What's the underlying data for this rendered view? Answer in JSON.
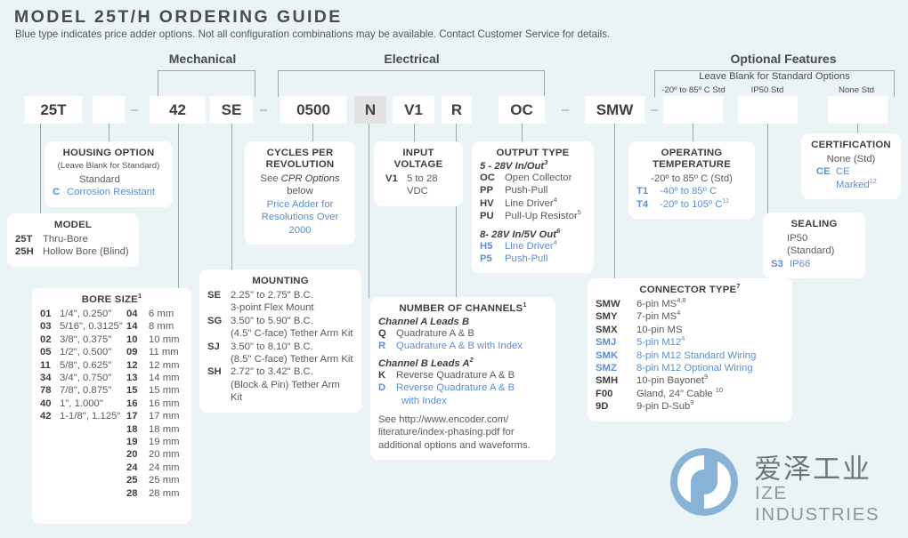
{
  "header": {
    "title": "MODEL 25T/H ORDERING GUIDE",
    "subtitle": "Blue type indicates price adder options. Not all configuration combinations may be available. Contact Customer Service for details."
  },
  "groups": {
    "mechanical": "Mechanical",
    "electrical": "Electrical",
    "optional_features": "Optional Features",
    "leave_blank": "Leave Blank for Standard Options"
  },
  "std_notes": {
    "temp": "-20º to 85º C Std",
    "sealing": "IP50 Std",
    "certification": "None Std"
  },
  "part_number": {
    "model": "25T",
    "housing": "",
    "dash1": "–",
    "bore": "42",
    "mounting": "SE",
    "dash2": "–",
    "cpr": "0500",
    "channels": "N",
    "voltage": "V1",
    "index": "R",
    "output": "OC",
    "dash3": "–",
    "connector": "SMW",
    "dash4": "–",
    "temperature": "",
    "sealing": "",
    "certification": ""
  },
  "housing_option": {
    "title": "HOUSING OPTION",
    "sub": "(Leave Blank for Standard)",
    "rows": [
      {
        "code": "",
        "desc": "Standard",
        "blue": false
      },
      {
        "code": "C",
        "desc": "Corrosion Resistant",
        "blue": true
      }
    ]
  },
  "model": {
    "title": "MODEL",
    "rows": [
      {
        "code": "25T",
        "desc": "Thru-Bore",
        "blue": false
      },
      {
        "code": "25H",
        "desc": "Hollow Bore (Blind)",
        "blue": false
      }
    ]
  },
  "bore_size": {
    "title": "BORE SIZE",
    "title_sup": "1",
    "col1": [
      {
        "code": "01",
        "desc": "1/4\", 0.250\""
      },
      {
        "code": "03",
        "desc": "5/16\", 0.3125\""
      },
      {
        "code": "02",
        "desc": "3/8\", 0.375\""
      },
      {
        "code": "05",
        "desc": "1/2\", 0.500\""
      },
      {
        "code": "11",
        "desc": "5/8\", 0.625\""
      },
      {
        "code": "34",
        "desc": "3/4\", 0.750\""
      },
      {
        "code": "78",
        "desc": "7/8\", 0.875\""
      },
      {
        "code": "40",
        "desc": "1\", 1.000\""
      },
      {
        "code": "42",
        "desc": "1-1/8\", 1.125\""
      }
    ],
    "col2": [
      {
        "code": "04",
        "desc": "6 mm"
      },
      {
        "code": "14",
        "desc": "8 mm"
      },
      {
        "code": "10",
        "desc": "10 mm"
      },
      {
        "code": "09",
        "desc": "11 mm"
      },
      {
        "code": "12",
        "desc": "12 mm"
      },
      {
        "code": "13",
        "desc": "14 mm"
      },
      {
        "code": "15",
        "desc": "15 mm"
      },
      {
        "code": "16",
        "desc": "16 mm"
      },
      {
        "code": "17",
        "desc": "17 mm"
      },
      {
        "code": "18",
        "desc": "18 mm"
      },
      {
        "code": "19",
        "desc": "19 mm"
      },
      {
        "code": "20",
        "desc": "20 mm"
      },
      {
        "code": "24",
        "desc": "24 mm"
      },
      {
        "code": "25",
        "desc": "25 mm"
      },
      {
        "code": "28",
        "desc": "28 mm"
      }
    ]
  },
  "cycles_per_revolution": {
    "title_line1": "CYCLES PER",
    "title_line2": "REVOLUTION",
    "line1_pre": "See ",
    "line1_ital": "CPR Options",
    "line1_post": " below",
    "blue_line1": "Price Adder for",
    "blue_line2": "Resolutions Over 2000"
  },
  "mounting": {
    "title": "MOUNTING",
    "rows": [
      {
        "code": "SE",
        "desc": "2.25\" to 2.75\" B.C.",
        "desc2": "3-point Flex Mount"
      },
      {
        "code": "SG",
        "desc": "3.50\" to 5.90\" B.C.",
        "desc2": "(4.5\" C-face) Tether Arm Kit"
      },
      {
        "code": "SJ",
        "desc": "3.50\" to 8.10\" B.C.",
        "desc2": "(8.5\" C-face) Tether Arm Kit"
      },
      {
        "code": "SH",
        "desc": "2.72\" to 3.42\" B.C.",
        "desc2": "(Block & Pin) Tether Arm Kit"
      }
    ]
  },
  "input_voltage": {
    "title_line1": "INPUT",
    "title_line2": "VOLTAGE",
    "rows": [
      {
        "code": "V1",
        "desc": "5 to 28 VDC",
        "blue": false
      }
    ]
  },
  "output_type": {
    "title": "OUTPUT TYPE",
    "group1_label": "5 - 28V In/Out",
    "group1_sup": "3",
    "group1": [
      {
        "code": "OC",
        "desc": "Open Collector",
        "sup": "",
        "blue": false
      },
      {
        "code": "PP",
        "desc": "Push-Pull",
        "sup": "",
        "blue": false
      },
      {
        "code": "HV",
        "desc": "Line Driver",
        "sup": "4",
        "blue": false
      },
      {
        "code": "PU",
        "desc": "Pull-Up Resistor",
        "sup": "5",
        "blue": false
      }
    ],
    "group2_label": "8- 28V In/5V Out",
    "group2_sup": "6",
    "group2": [
      {
        "code": "H5",
        "desc": "Line Driver",
        "sup": "4",
        "blue": true
      },
      {
        "code": "P5",
        "desc": "Push-Pull",
        "sup": "",
        "blue": true
      }
    ]
  },
  "number_of_channels": {
    "title": "NUMBER OF CHANNELS",
    "title_sup": "1",
    "group1_label": "Channel A Leads B",
    "group1_sup": "",
    "group1": [
      {
        "code": "Q",
        "desc": "Quadrature A & B",
        "blue": false
      },
      {
        "code": "R",
        "desc": "Quadrature A & B with Index",
        "blue": true
      }
    ],
    "group2_label": "Channel B Leads A",
    "group2_sup": "2",
    "group2": [
      {
        "code": "K",
        "desc": "Reverse Quadrature A & B",
        "desc2": "",
        "blue": false
      },
      {
        "code": "D",
        "desc": "Reverse Quadrature A & B",
        "desc2": "with Index",
        "blue": true
      }
    ],
    "note_line1": "See http://www.encoder.com/",
    "note_line2": "literature/index-phasing.pdf for",
    "note_line3": "additional options and waveforms."
  },
  "operating_temperature": {
    "title_line1": "OPERATING",
    "title_line2": "TEMPERATURE",
    "std": "-20º to 85º C (Std)",
    "rows": [
      {
        "code": "T1",
        "desc": "-40º to 85º C",
        "sup": "",
        "blue": true
      },
      {
        "code": "T4",
        "desc": "-20º to 105º C",
        "sup": "11",
        "blue": true
      }
    ]
  },
  "connector_type": {
    "title": "CONNECTOR TYPE",
    "title_sup": "7",
    "rows": [
      {
        "code": "SMW",
        "desc": "6-pin MS",
        "sup": "4,8",
        "blue": false
      },
      {
        "code": "SMY",
        "desc": "7-pin MS",
        "sup": "4",
        "blue": false
      },
      {
        "code": "SMX",
        "desc": "10-pin MS",
        "sup": "",
        "blue": false
      },
      {
        "code": "SMJ",
        "desc": "5-pin M12",
        "sup": "4",
        "blue": true
      },
      {
        "code": "SMK",
        "desc": "8-pin M12 Standard Wiring",
        "sup": "",
        "blue": true
      },
      {
        "code": "SMZ",
        "desc": "8-pin M12 Optional Wiring",
        "sup": "",
        "blue": true
      },
      {
        "code": "SMH",
        "desc": "10-pin Bayonet",
        "sup": "9",
        "blue": false
      },
      {
        "code": "F00",
        "desc": "Gland, 24\" Cable ",
        "sup": "10",
        "blue": false
      },
      {
        "code": "9D",
        "desc": "9-pin D-Sub",
        "sup": "9",
        "blue": false
      }
    ]
  },
  "sealing": {
    "title": "SEALING",
    "rows": [
      {
        "code": "",
        "desc": "IP50 (Standard)",
        "blue": false
      },
      {
        "code": "S3",
        "desc": "IP66",
        "blue": true
      }
    ]
  },
  "certification": {
    "title": "CERTIFICATION",
    "std": "None (Std)",
    "rows": [
      {
        "code": "CE",
        "desc": "CE Marked",
        "sup": "12",
        "blue": true
      }
    ]
  },
  "logo": {
    "cn": "爱泽工业",
    "en": "IZE INDUSTRIES",
    "color": "#89b3d6"
  }
}
